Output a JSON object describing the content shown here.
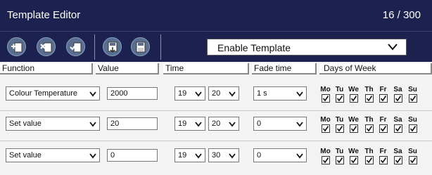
{
  "header": {
    "title": "Template Editor",
    "counter": "16 / 300"
  },
  "toolbar": {
    "enable_select": "Enable Template",
    "buttons": [
      "add-template",
      "delete-template",
      "apply-template",
      "save-template",
      "save-as-template"
    ]
  },
  "columns": {
    "function": "Function",
    "value": "Value",
    "time": "Time",
    "fade": "Fade time",
    "days": "Days of Week"
  },
  "days": [
    "Mo",
    "Tu",
    "We",
    "Th",
    "Fr",
    "Sa",
    "Su"
  ],
  "rows": [
    {
      "function": "Colour Temperature",
      "value": "2000",
      "hour": "19",
      "minute": "20",
      "fade": "1 s",
      "checked": [
        true,
        true,
        true,
        true,
        true,
        true,
        true
      ]
    },
    {
      "function": "Set value",
      "value": "20",
      "hour": "19",
      "minute": "20",
      "fade": "0",
      "checked": [
        true,
        true,
        true,
        true,
        true,
        true,
        true
      ]
    },
    {
      "function": "Set value",
      "value": "0",
      "hour": "19",
      "minute": "30",
      "fade": "0",
      "checked": [
        true,
        true,
        true,
        true,
        true,
        true,
        true
      ]
    }
  ],
  "colors": {
    "header_bg": "#1c2150",
    "icon_bg": "#5a6f8f"
  }
}
